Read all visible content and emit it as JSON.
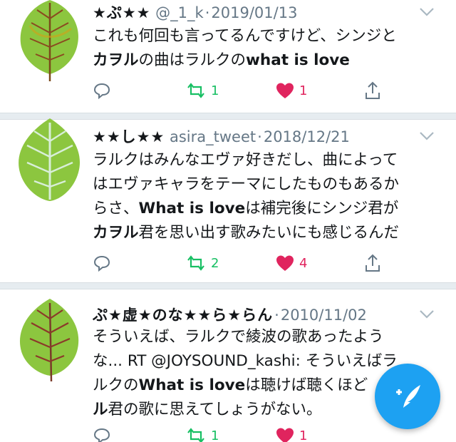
{
  "tweets": [
    {
      "handle_name": "★ぷ★★",
      "handle": "@_1_k",
      "date": "2019/01/13",
      "body": [
        [
          {
            "t": "これも何回も言ってるんですけど、シンジと",
            "b": false
          }
        ],
        [
          {
            "t": "カヲル",
            "b": true
          },
          {
            "t": "の曲はラルクの",
            "b": false
          },
          {
            "t": "what is love",
            "b": true
          }
        ]
      ],
      "reply_count": "",
      "retweet_count": "1",
      "like_count": "1"
    },
    {
      "handle_name": "★★し★★",
      "handle": "asira_tweet",
      "date": "2018/12/21",
      "body": [
        [
          {
            "t": "ラルクはみんなエヴァ好きだし、曲によって",
            "b": false
          }
        ],
        [
          {
            "t": "はエヴァキャラをテーマにしたものもあるか",
            "b": false
          }
        ],
        [
          {
            "t": "らさ、",
            "b": false
          },
          {
            "t": "What is love",
            "b": true
          },
          {
            "t": "は補完後にシンジ君が",
            "b": false
          }
        ],
        [
          {
            "t": "カヲル",
            "b": true
          },
          {
            "t": "君を思い出す歌みたいにも感じるんだ",
            "b": false
          }
        ]
      ],
      "reply_count": "",
      "retweet_count": "2",
      "like_count": "4"
    },
    {
      "handle_name": "ぷ★虚★のな★★ら★らん",
      "handle": "",
      "date": "2010/11/02",
      "body": [
        [
          {
            "t": "そういえば、ラルクで綾波の歌あったよう",
            "b": false
          }
        ],
        [
          {
            "t": "な... RT @JOYSOUND_kashi: そういえばラ",
            "b": false
          }
        ],
        [
          {
            "t": "ルクの",
            "b": false
          },
          {
            "t": "What is love",
            "b": true
          },
          {
            "t": "は聴けば聴くほど",
            "b": false
          }
        ],
        [
          {
            "t": "ル",
            "b": true
          },
          {
            "t": "君の歌に思えてしょうがない。",
            "b": false
          }
        ]
      ],
      "reply_count": "",
      "retweet_count": "1",
      "like_count": "1"
    }
  ],
  "colors": {
    "retweet": "#17bf63",
    "like": "#e0245e",
    "icon_gray": "#657786",
    "fab": "#1da1f2",
    "leaf": "#8cc63f"
  },
  "icons": {
    "reply": "reply-icon",
    "retweet": "retweet-icon",
    "like": "heart-icon",
    "share": "share-icon",
    "caret": "chevron-down-icon",
    "compose": "compose-tweet-icon"
  }
}
